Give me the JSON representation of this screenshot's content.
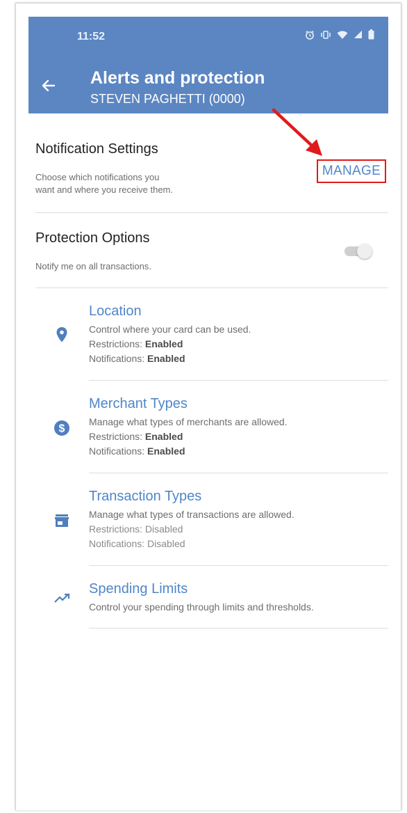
{
  "status_bar": {
    "time": "11:52",
    "icons": [
      "alarm-icon",
      "vibrate-icon",
      "wifi-icon",
      "signal-icon",
      "battery-icon"
    ]
  },
  "header": {
    "title": "Alerts and protection",
    "subtitle": "STEVEN PAGHETTI (0000)",
    "back_icon": "arrow-left-icon",
    "color": "#5b86c2"
  },
  "notification_settings": {
    "heading": "Notification Settings",
    "description_line1": "Choose which notifications you",
    "description_line2": "want and where you receive them.",
    "manage_label": "MANAGE",
    "highlight_color": "#e01a1a"
  },
  "protection_options": {
    "heading": "Protection Options",
    "description": "Notify me on all transactions.",
    "toggle_on": false
  },
  "items": [
    {
      "icon": "location-pin-icon",
      "title": "Location",
      "description": "Control where your card can be used.",
      "restrictions_label": "Restrictions:",
      "restrictions_value": "Enabled",
      "notifications_label": "Notifications:",
      "notifications_value": "Enabled"
    },
    {
      "icon": "dollar-circle-icon",
      "title": "Merchant Types",
      "description": "Manage what types of merchants are allowed.",
      "restrictions_label": "Restrictions:",
      "restrictions_value": "Enabled",
      "notifications_label": "Notifications:",
      "notifications_value": "Enabled"
    },
    {
      "icon": "storefront-icon",
      "title": "Transaction Types",
      "description": "Manage what types of transactions are allowed.",
      "restrictions_text": "Restrictions: Disabled",
      "notifications_text": "Notifications: Disabled"
    },
    {
      "icon": "trending-up-icon",
      "title": "Spending Limits",
      "description": "Control your spending through limits and thresholds."
    }
  ],
  "colors": {
    "accent": "#4f86c9",
    "icon": "#4f7fbf",
    "annotation_arrow": "#e01a1a"
  }
}
